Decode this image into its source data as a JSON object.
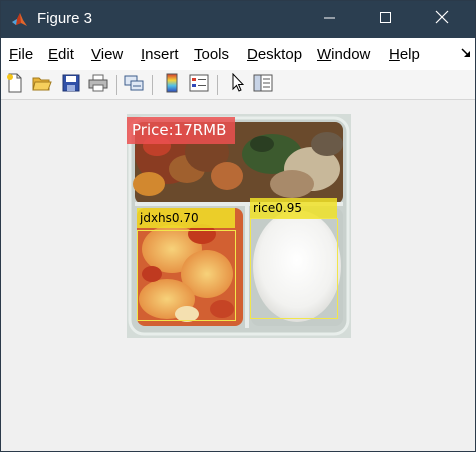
{
  "window": {
    "title": "Figure 3",
    "controls": {
      "minimize": "minimize",
      "maximize": "maximize",
      "close": "close"
    }
  },
  "menu": [
    {
      "label": "File",
      "mnemonic": "F",
      "rest": "ile"
    },
    {
      "label": "Edit",
      "mnemonic": "E",
      "rest": "dit"
    },
    {
      "label": "View",
      "mnemonic": "V",
      "rest": "iew"
    },
    {
      "label": "Insert",
      "mnemonic": "I",
      "rest": "nsert"
    },
    {
      "label": "Tools",
      "mnemonic": "T",
      "rest": "ools"
    },
    {
      "label": "Desktop",
      "mnemonic": "D",
      "rest": "esktop"
    },
    {
      "label": "Window",
      "mnemonic": "W",
      "rest": "indow"
    },
    {
      "label": "Help",
      "mnemonic": "H",
      "rest": "elp"
    }
  ],
  "toolbar": {
    "icons": [
      "new-figure-icon",
      "open-file-icon",
      "save-figure-icon",
      "print-figure-icon",
      "link-plot-icon",
      "insert-colorbar-icon",
      "insert-legend-icon",
      "edit-plot-icon",
      "open-property-inspector-icon"
    ]
  },
  "figure": {
    "price_label": "Price:17RMB",
    "detections": [
      {
        "label": "jdxhs0.70",
        "class": "jdxhs",
        "score": "0.70"
      },
      {
        "label": "rice0.95",
        "class": "rice",
        "score": "0.95"
      }
    ]
  },
  "colors": {
    "titlebar": "#2b3e50",
    "price_bg": "#eb5050",
    "detection_box": "#f2e64a"
  }
}
